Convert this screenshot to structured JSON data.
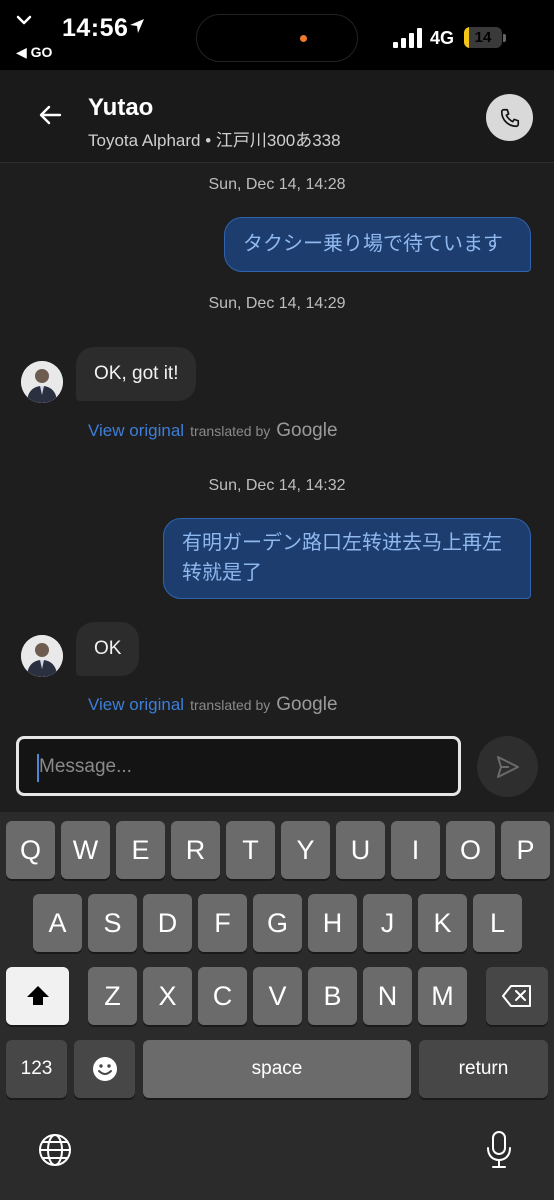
{
  "status_bar": {
    "time": "14:56",
    "back_label": "◀ GO",
    "network": "4G",
    "battery_level": "14",
    "battery_fraction": 0.14
  },
  "header": {
    "driver_name": "Yutao",
    "vehicle_info": "Toyota Alphard • 江戸川300あ338"
  },
  "chat": {
    "messages": [
      {
        "timestamp": "Sun, Dec 14, 14:28",
        "direction": "outgoing",
        "text": "タクシー乗り場で待ています"
      },
      {
        "timestamp": "Sun, Dec 14, 14:29",
        "direction": "incoming",
        "text": "OK, got it!"
      },
      {
        "timestamp": "Sun, Dec 14, 14:32",
        "direction": "outgoing",
        "text_line1": "有明ガーデン路口左转进去马上再左",
        "text_line2": "转就是了"
      },
      {
        "direction": "incoming",
        "text": "OK"
      }
    ],
    "view_original": "View original",
    "translated_by": "translated by",
    "google": "Google"
  },
  "composer": {
    "placeholder": "Message..."
  },
  "keyboard": {
    "row1": [
      "Q",
      "W",
      "E",
      "R",
      "T",
      "Y",
      "U",
      "I",
      "O",
      "P"
    ],
    "row2": [
      "A",
      "S",
      "D",
      "F",
      "G",
      "H",
      "J",
      "K",
      "L"
    ],
    "row3": [
      "Z",
      "X",
      "C",
      "V",
      "B",
      "N",
      "M"
    ],
    "numbers_label": "123",
    "space_label": "space",
    "return_label": "return"
  },
  "icons": {
    "shift": "shift-arrow-icon",
    "backspace": "backspace-icon",
    "emoji": "emoji-icon",
    "globe": "globe-icon",
    "mic": "microphone-icon",
    "send": "send-icon",
    "phone": "phone-icon",
    "back": "back-arrow-icon"
  },
  "colors": {
    "outgoing_bubble": "#1c3d6e",
    "outgoing_text": "#8fb8ee",
    "link": "#3d7ed6",
    "battery": "#f5c518"
  }
}
